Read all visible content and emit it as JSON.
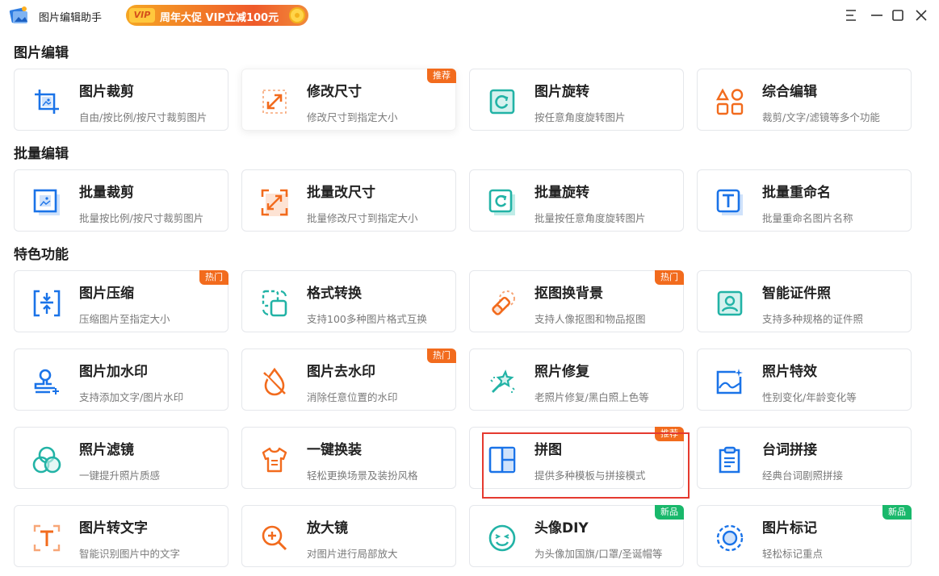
{
  "app": {
    "title": "图片编辑助手"
  },
  "vip_banner": {
    "badge": "VIP",
    "text": "周年大促 VIP立减100元"
  },
  "window_controls": [
    "menu-icon",
    "minimize-icon",
    "maximize-icon",
    "close-icon"
  ],
  "colors": {
    "blue": "#1a73e8",
    "orange": "#f26b1d",
    "teal": "#22b3a6",
    "highlight": "#e53a2f",
    "tag_new": "#19b86b"
  },
  "sections": [
    {
      "title": "图片编辑",
      "cards": [
        {
          "title": "图片裁剪",
          "desc": "自由/按比例/按尺寸裁剪图片",
          "icon": "crop-icon",
          "tag": ""
        },
        {
          "title": "修改尺寸",
          "desc": "修改尺寸到指定大小",
          "icon": "resize-icon",
          "tag": "推荐"
        },
        {
          "title": "图片旋转",
          "desc": "按任意角度旋转图片",
          "icon": "rotate-icon",
          "tag": ""
        },
        {
          "title": "综合编辑",
          "desc": "裁剪/文字/滤镜等多个功能",
          "icon": "shapes-icon",
          "tag": ""
        }
      ]
    },
    {
      "title": "批量编辑",
      "cards": [
        {
          "title": "批量裁剪",
          "desc": "批量按比例/按尺寸裁剪图片",
          "icon": "batch-crop-icon",
          "tag": ""
        },
        {
          "title": "批量改尺寸",
          "desc": "批量修改尺寸到指定大小",
          "icon": "batch-resize-icon",
          "tag": ""
        },
        {
          "title": "批量旋转",
          "desc": "批量按任意角度旋转图片",
          "icon": "batch-rotate-icon",
          "tag": ""
        },
        {
          "title": "批量重命名",
          "desc": "批量重命名图片名称",
          "icon": "rename-icon",
          "tag": ""
        }
      ]
    },
    {
      "title": "特色功能",
      "cards": [
        {
          "title": "图片压缩",
          "desc": "压缩图片至指定大小",
          "icon": "compress-icon",
          "tag": "热门"
        },
        {
          "title": "格式转换",
          "desc": "支持100多种图片格式互换",
          "icon": "convert-icon",
          "tag": ""
        },
        {
          "title": "抠图换背景",
          "desc": "支持人像抠图和物品抠图",
          "icon": "eraser-icon",
          "tag": "热门"
        },
        {
          "title": "智能证件照",
          "desc": "支持多种规格的证件照",
          "icon": "id-photo-icon",
          "tag": ""
        },
        {
          "title": "图片加水印",
          "desc": "支持添加文字/图片水印",
          "icon": "stamp-icon",
          "tag": ""
        },
        {
          "title": "图片去水印",
          "desc": "消除任意位置的水印",
          "icon": "drop-off-icon",
          "tag": "热门"
        },
        {
          "title": "照片修复",
          "desc": "老照片修复/黑白照上色等",
          "icon": "magic-wand-icon",
          "tag": ""
        },
        {
          "title": "照片特效",
          "desc": "性别变化/年龄变化等",
          "icon": "landscape-icon",
          "tag": ""
        },
        {
          "title": "照片滤镜",
          "desc": "一键提升照片质感",
          "icon": "filter-icon",
          "tag": ""
        },
        {
          "title": "一键换装",
          "desc": "轻松更换场景及装扮风格",
          "icon": "shirt-icon",
          "tag": ""
        },
        {
          "title": "拼图",
          "desc": "提供多种模板与拼接模式",
          "icon": "collage-icon",
          "tag": "推荐"
        },
        {
          "title": "台词拼接",
          "desc": "经典台词剧照拼接",
          "icon": "clipboard-icon",
          "tag": ""
        },
        {
          "title": "图片转文字",
          "desc": "智能识别图片中的文字",
          "icon": "ocr-icon",
          "tag": ""
        },
        {
          "title": "放大镜",
          "desc": "对图片进行局部放大",
          "icon": "magnifier-icon",
          "tag": ""
        },
        {
          "title": "头像DIY",
          "desc": "为头像加国旗/口罩/圣诞帽等",
          "icon": "smiley-icon",
          "tag": "新品"
        },
        {
          "title": "图片标记",
          "desc": "轻松标记重点",
          "icon": "mark-icon",
          "tag": "新品"
        }
      ]
    }
  ]
}
